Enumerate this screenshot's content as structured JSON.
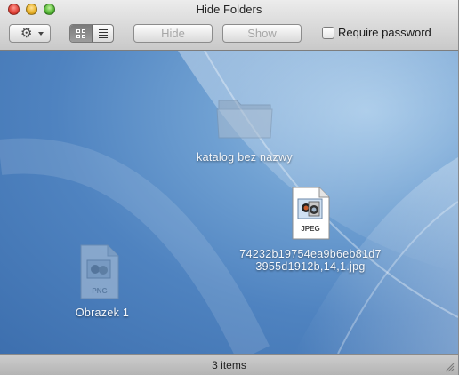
{
  "window": {
    "title": "Hide Folders"
  },
  "toolbar": {
    "action_icon": "gear-icon",
    "view_icons_label": "icon view",
    "view_list_label": "list view",
    "hide_label": "Hide",
    "show_label": "Show",
    "require_password_label": "Require password",
    "require_password_checked": false
  },
  "items": {
    "folder": {
      "name": "katalog bez nazwy",
      "icon": "folder-icon"
    },
    "jpeg": {
      "name_line1": "74232b19754ea9b6eb81d7",
      "name_line2": "3955d1912b,14,1.jpg",
      "badge": "JPEG",
      "icon": "jpeg-file-icon"
    },
    "png": {
      "name": "Obrazek 1",
      "badge": "PNG",
      "icon": "png-file-icon"
    }
  },
  "status": {
    "text": "3 items"
  },
  "colors": {
    "background_blue": "#4f83c0",
    "close": "#e2463c",
    "minimize": "#e9b32a",
    "zoom": "#59b93a"
  }
}
